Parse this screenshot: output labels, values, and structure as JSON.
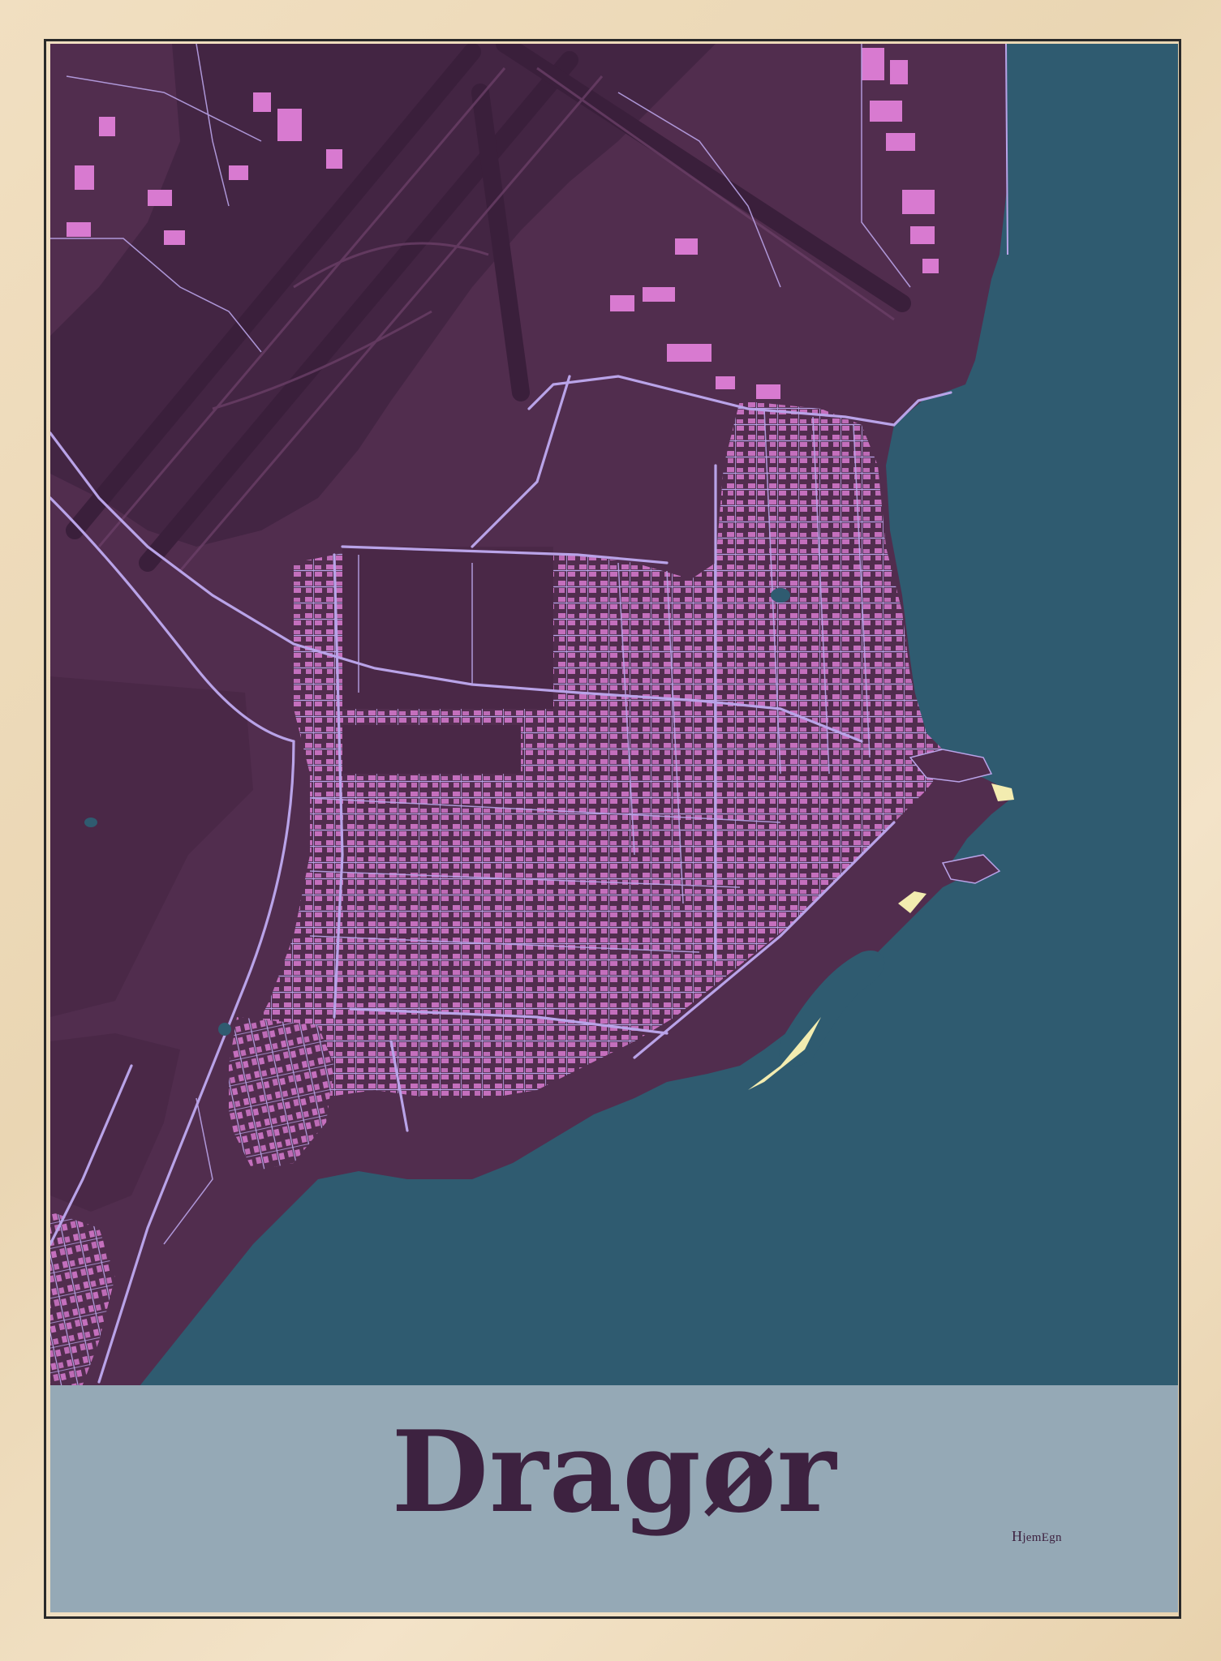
{
  "poster": {
    "title": "Dragør",
    "brand": {
      "initial": "H",
      "rest": "jemEgn"
    }
  },
  "colors": {
    "frame": "#ecd9b8",
    "land": "#512d4e",
    "land_dark": "#3f2340",
    "water": "#2f5b70",
    "buildings": "#d87ad0",
    "roads": "#b9a3e8",
    "beach": "#f3ecb0",
    "band": "#95a9b6",
    "title_text": "#3d2240"
  },
  "map": {
    "style": "city-poster",
    "features": [
      "land",
      "sea",
      "roads",
      "buildings",
      "airport-runways",
      "harbour",
      "beach",
      "lakes"
    ]
  }
}
